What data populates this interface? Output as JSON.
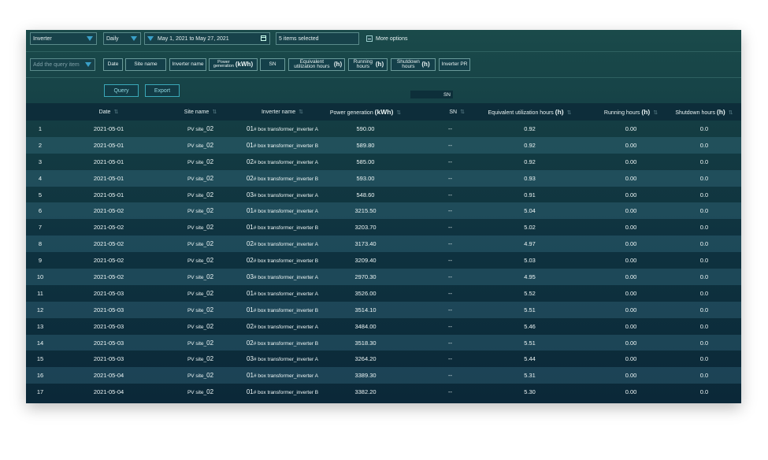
{
  "filters": {
    "type": "Inverter",
    "period": "Daily",
    "date_range": "May 1, 2021 to May 27, 2021",
    "items_selected": "5 items selected",
    "more_options": "More options"
  },
  "query_bar": {
    "placeholder": "Add the query item",
    "chips": [
      {
        "text": "Date",
        "unit": ""
      },
      {
        "text": "Site name",
        "unit": ""
      },
      {
        "text": "Inverter name",
        "unit": ""
      },
      {
        "text": "Power generation",
        "unit": "(kWh)"
      },
      {
        "text": "SN",
        "unit": ""
      },
      {
        "text": "Equivalent utilization hours",
        "unit": "(h)"
      },
      {
        "text": "Running hours",
        "unit": "(h)"
      },
      {
        "text": "Shutdown hours",
        "unit": "(h)"
      },
      {
        "text": "Inverter PR",
        "unit": ""
      }
    ]
  },
  "actions": {
    "query": "Query",
    "export": "Export"
  },
  "sn_filter": "SN",
  "table": {
    "headers": [
      {
        "text": "",
        "unit": ""
      },
      {
        "text": "Date",
        "unit": ""
      },
      {
        "text": "Site name",
        "unit": ""
      },
      {
        "text": "Inverter name",
        "unit": ""
      },
      {
        "text": "Power generation",
        "unit": "(kWh)"
      },
      {
        "text": "SN",
        "unit": ""
      },
      {
        "text": "Equivalent utilization hours",
        "unit": "(h)"
      },
      {
        "text": "Running hours",
        "unit": "(h)"
      },
      {
        "text": "Shutdown hours",
        "unit": "(h)"
      }
    ],
    "rows": [
      {
        "n": "1",
        "date": "2021-05-01",
        "site_a": "PV site_",
        "site_b": "02",
        "inv_a": "01",
        "inv_b": "# box transformer_inverter A",
        "power": "590.00",
        "sn": "--",
        "equiv": "0.92",
        "run": "0.00",
        "shut": "0.0"
      },
      {
        "n": "2",
        "date": "2021-05-01",
        "site_a": "PV site_",
        "site_b": "02",
        "inv_a": "01",
        "inv_b": "# box transformer_inverter B",
        "power": "589.80",
        "sn": "--",
        "equiv": "0.92",
        "run": "0.00",
        "shut": "0.0"
      },
      {
        "n": "3",
        "date": "2021-05-01",
        "site_a": "PV site_",
        "site_b": "02",
        "inv_a": "02",
        "inv_b": "# box transformer_inverter A",
        "power": "585.00",
        "sn": "--",
        "equiv": "0.92",
        "run": "0.00",
        "shut": "0.0"
      },
      {
        "n": "4",
        "date": "2021-05-01",
        "site_a": "PV site_",
        "site_b": "02",
        "inv_a": "02",
        "inv_b": "# box transformer_inverter B",
        "power": "593.00",
        "sn": "--",
        "equiv": "0.93",
        "run": "0.00",
        "shut": "0.0"
      },
      {
        "n": "5",
        "date": "2021-05-01",
        "site_a": "PV site_",
        "site_b": "02",
        "inv_a": "03",
        "inv_b": "# box transformer_inverter A",
        "power": "548.60",
        "sn": "--",
        "equiv": "0.91",
        "run": "0.00",
        "shut": "0.0"
      },
      {
        "n": "6",
        "date": "2021-05-02",
        "site_a": "PV site_",
        "site_b": "02",
        "inv_a": "01",
        "inv_b": "# box transformer_inverter A",
        "power": "3215.50",
        "sn": "--",
        "equiv": "5.04",
        "run": "0.00",
        "shut": "0.0"
      },
      {
        "n": "7",
        "date": "2021-05-02",
        "site_a": "PV site_",
        "site_b": "02",
        "inv_a": "01",
        "inv_b": "# box transformer_inverter B",
        "power": "3203.70",
        "sn": "--",
        "equiv": "5.02",
        "run": "0.00",
        "shut": "0.0"
      },
      {
        "n": "8",
        "date": "2021-05-02",
        "site_a": "PV site_",
        "site_b": "02",
        "inv_a": "02",
        "inv_b": "# box transformer_inverter A",
        "power": "3173.40",
        "sn": "--",
        "equiv": "4.97",
        "run": "0.00",
        "shut": "0.0"
      },
      {
        "n": "9",
        "date": "2021-05-02",
        "site_a": "PV site_",
        "site_b": "02",
        "inv_a": "02",
        "inv_b": "# box transformer_inverter B",
        "power": "3209.40",
        "sn": "--",
        "equiv": "5.03",
        "run": "0.00",
        "shut": "0.0"
      },
      {
        "n": "10",
        "date": "2021-05-02",
        "site_a": "PV site_",
        "site_b": "02",
        "inv_a": "03",
        "inv_b": "# box transformer_inverter A",
        "power": "2970.30",
        "sn": "--",
        "equiv": "4.95",
        "run": "0.00",
        "shut": "0.0"
      },
      {
        "n": "11",
        "date": "2021-05-03",
        "site_a": "PV site_",
        "site_b": "02",
        "inv_a": "01",
        "inv_b": "# box transformer_inverter A",
        "power": "3526.00",
        "sn": "--",
        "equiv": "5.52",
        "run": "0.00",
        "shut": "0.0"
      },
      {
        "n": "12",
        "date": "2021-05-03",
        "site_a": "PV site_",
        "site_b": "02",
        "inv_a": "01",
        "inv_b": "# box transformer_inverter B",
        "power": "3514.10",
        "sn": "--",
        "equiv": "5.51",
        "run": "0.00",
        "shut": "0.0"
      },
      {
        "n": "13",
        "date": "2021-05-03",
        "site_a": "PV site_",
        "site_b": "02",
        "inv_a": "02",
        "inv_b": "# box transformer_inverter A",
        "power": "3484.00",
        "sn": "--",
        "equiv": "5.46",
        "run": "0.00",
        "shut": "0.0"
      },
      {
        "n": "14",
        "date": "2021-05-03",
        "site_a": "PV site_",
        "site_b": "02",
        "inv_a": "02",
        "inv_b": "# box transformer_inverter B",
        "power": "3518.30",
        "sn": "--",
        "equiv": "5.51",
        "run": "0.00",
        "shut": "0.0"
      },
      {
        "n": "15",
        "date": "2021-05-03",
        "site_a": "PV site_",
        "site_b": "02",
        "inv_a": "03",
        "inv_b": "# box transformer_inverter A",
        "power": "3264.20",
        "sn": "--",
        "equiv": "5.44",
        "run": "0.00",
        "shut": "0.0"
      },
      {
        "n": "16",
        "date": "2021-05-04",
        "site_a": "PV site_",
        "site_b": "02",
        "inv_a": "01",
        "inv_b": "# box transformer_inverter A",
        "power": "3389.30",
        "sn": "--",
        "equiv": "5.31",
        "run": "0.00",
        "shut": "0.0"
      },
      {
        "n": "17",
        "date": "2021-05-04",
        "site_a": "PV site_",
        "site_b": "02",
        "inv_a": "01",
        "inv_b": "# box transformer_inverter B",
        "power": "3382.20",
        "sn": "--",
        "equiv": "5.30",
        "run": "0.00",
        "shut": "0.0"
      }
    ]
  }
}
